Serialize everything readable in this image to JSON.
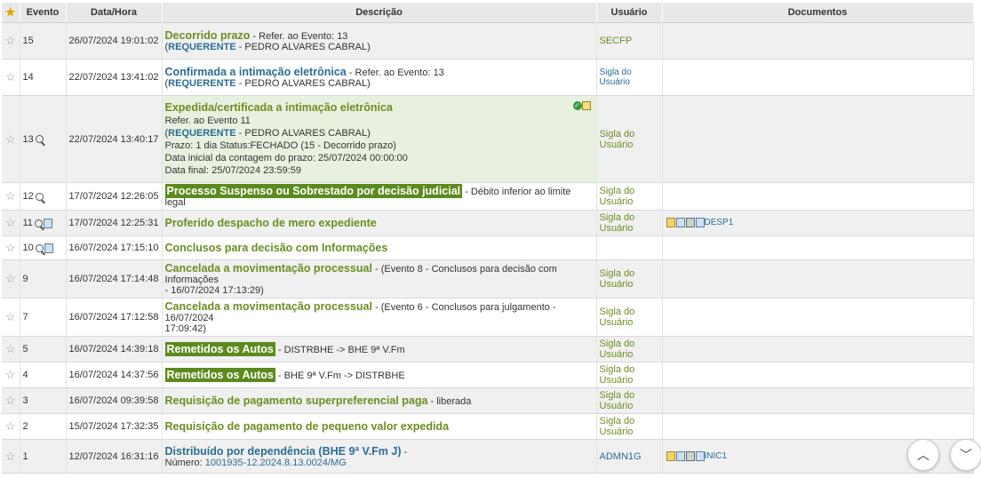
{
  "headers": {
    "evento": "Evento",
    "datahora": "Data/Hora",
    "descricao": "Descrição",
    "usuario": "Usuário",
    "documentos": "Documentos"
  },
  "rows": [
    {
      "ev": "15",
      "dt": "26/07/2024 19:01:02",
      "title": "Decorrido prazo",
      "suffix": " - Refer. ao Evento: 13",
      "req": "REQUERENTE",
      "reqsuffix": " - PEDRO ALVARES CABRAL)",
      "user": "SECFP"
    },
    {
      "ev": "14",
      "dt": "22/07/2024 13:41:02",
      "title": "Confirmada a intimação eletrônica",
      "suffix": " - Refer. ao Evento: 13",
      "req": "REQUERENTE",
      "reqsuffix": " - PEDRO ALVARES CABRAL)",
      "user": "Sigla do Usuário"
    },
    {
      "ev": "13",
      "dt": "22/07/2024 13:40:17",
      "title": "Expedida/certificada a intimação eletrônica",
      "line1": "Refer. ao Evento 11",
      "req": "REQUERENTE",
      "reqsuffix": " - PEDRO ALVARES CABRAL)",
      "line3": "Prazo: 1 dia Status:FECHADO (15 - Decorrido prazo)",
      "line4": "Data inicial da contagem do prazo: 25/07/2024 00:00:00",
      "line5": "Data final: 25/07/2024 23:59:59",
      "user": "Sigla do Usuário"
    },
    {
      "ev": "12",
      "dt": "17/07/2024 12:26:05",
      "title": "Processo Suspenso ou Sobrestado por decisão judicial",
      "suffix": " - Débito inferior ao limite legal",
      "user": "Sigla do Usuário"
    },
    {
      "ev": "11",
      "dt": "17/07/2024 12:25:31",
      "title": "Proferido despacho de mero expediente",
      "user": "Sigla do Usuário",
      "doc": "DESP1"
    },
    {
      "ev": "10",
      "dt": "16/07/2024 17:15:10",
      "title": "Conclusos para decisão com Informações"
    },
    {
      "ev": "9",
      "dt": "16/07/2024 17:14:48",
      "title": "Cancelada a movimentação processual",
      "suffix": " - (Evento 8 - Conclusos para decisão com Informações",
      "suffix2": "- 16/07/2024 17:13:29)",
      "user": "Sigla do Usuário"
    },
    {
      "ev": "7",
      "dt": "16/07/2024 17:12:58",
      "title": "Cancelada a movimentação processual",
      "suffix": " - (Evento 6 - Conclusos para julgamento - 16/07/2024",
      "suffix2": "17:09:42)",
      "user": "Sigla do Usuário"
    },
    {
      "ev": "5",
      "dt": "16/07/2024 14:39:18",
      "title": "Remetidos os Autos",
      "suffix": " - DISTRBHE -> BHE 9ª V.Fm",
      "user": "Sigla do Usuário"
    },
    {
      "ev": "4",
      "dt": "16/07/2024 14:37:56",
      "title": "Remetidos os Autos",
      "suffix": " - BHE 9ª V.Fm -> DISTRBHE",
      "user": "Sigla do Usuário"
    },
    {
      "ev": "3",
      "dt": "16/07/2024 09:39:58",
      "title": "Requisição de pagamento superpreferencial paga",
      "suffix": " - liberada",
      "user": "Sigla do Usuário"
    },
    {
      "ev": "2",
      "dt": "15/07/2024 17:32:35",
      "title": "Requisição de pagamento de pequeno valor expedida",
      "user": "Sigla do Usuário"
    },
    {
      "ev": "1",
      "dt": "12/07/2024 16:31:16",
      "title": "Distribuído por dependência (BHE 9ª V.Fm J)",
      "suffix": " -",
      "numlabel": "Número: ",
      "num": "1001935-12.2024.8.13.0024/MG",
      "user": "ADMN1G",
      "doc": "INIC1"
    }
  ],
  "colors": {
    "green": "#6b8e23",
    "blue": "#2b6c94",
    "highlight": "#5d8a1e"
  }
}
